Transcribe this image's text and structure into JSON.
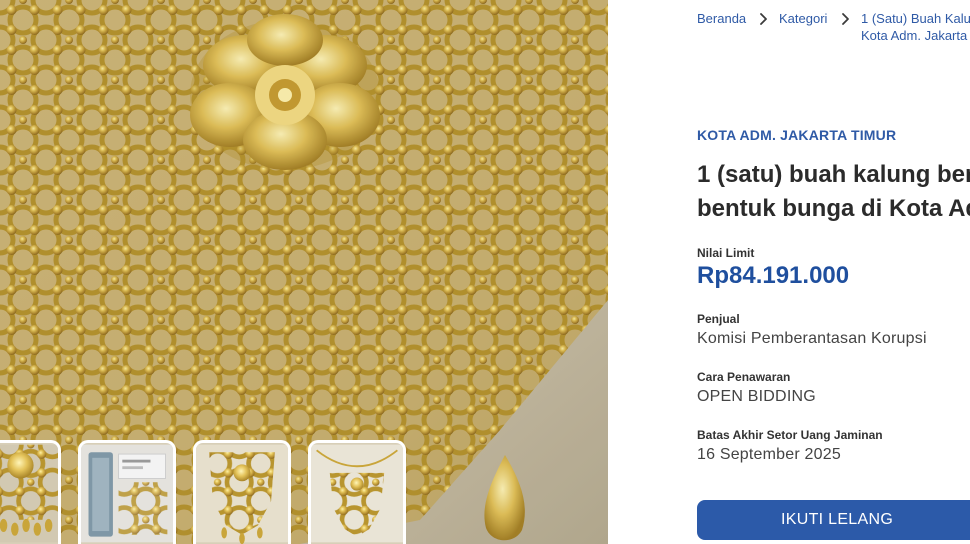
{
  "breadcrumb": {
    "home": "Beranda",
    "category": "Kategori",
    "current_line1": "1 (Satu) Buah Kalun",
    "current_line2": "Kota Adm. Jakarta"
  },
  "gallery": {
    "main_photo_icon": "gold-mesh-necklace-photo",
    "thumbnails": [
      {
        "icon": "necklace-closeup-thumbnail"
      },
      {
        "icon": "packaged-necklace-thumbnail"
      },
      {
        "icon": "necklace-full-view-thumbnail"
      },
      {
        "icon": "necklace-flat-lay-thumbnail"
      }
    ]
  },
  "listing": {
    "region": "KOTA ADM. JAKARTA TIMUR",
    "title_line1": "1 (satu) buah kalung berv",
    "title_line2": "bentuk bunga di Kota Ad"
  },
  "fields": {
    "limit_label": "Nilai Limit",
    "limit_value": "Rp84.191.000",
    "seller_label": "Penjual",
    "seller_value": "Komisi Pemberantasan Korupsi",
    "method_label": "Cara Penawaran",
    "method_value": "OPEN BIDDING",
    "deadline_label": "Batas Akhir Setor Uang Jaminan",
    "deadline_value": "16 September 2025"
  },
  "actions": {
    "join_label": "IKUTI LELANG"
  },
  "colors": {
    "accent": "#2c5aa9",
    "price": "#1f4f9e",
    "link": "#2f5aa6",
    "gold": "#c9a53a"
  }
}
